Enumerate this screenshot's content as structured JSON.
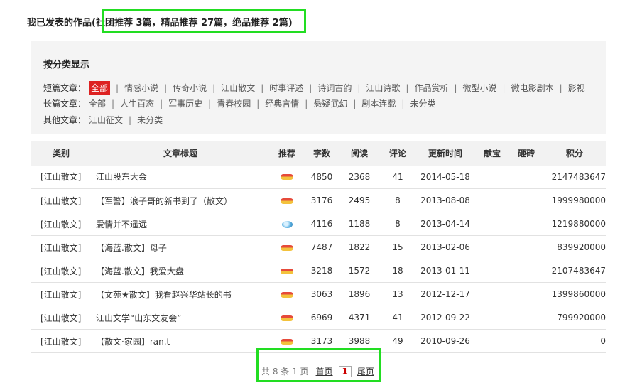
{
  "header": {
    "title": "我已发表的作品",
    "stats": "(社团推荐 3篇，精品推荐 27篇，绝品推荐 2篇)"
  },
  "categories": {
    "heading": "按分类显示",
    "short": {
      "label": "短篇文章：",
      "items": [
        "全部",
        "情感小说",
        "传奇小说",
        "江山散文",
        "时事评述",
        "诗词古韵",
        "江山诗歌",
        "作品赏析",
        "微型小说",
        "微电影剧本",
        "影视"
      ]
    },
    "long": {
      "label": "长篇文章：",
      "items": [
        "全部",
        "人生百态",
        "军事历史",
        "青春校园",
        "经典言情",
        "悬疑武幻",
        "剧本连载",
        "未分类"
      ]
    },
    "other": {
      "label": "其他文章：",
      "items": [
        "江山征文",
        "未分类"
      ]
    },
    "active_color": "#dd2222"
  },
  "table": {
    "headers": [
      "类别",
      "文章标题",
      "推荐",
      "字数",
      "阅读",
      "评论",
      "更新时间",
      "献宝",
      "砸砖",
      "积分"
    ],
    "rows": [
      {
        "cat": "[江山散文]",
        "title": "江山股东大会",
        "rec": "medal-icon",
        "words": "4850",
        "reads": "2368",
        "comments": "41",
        "date": "2014-05-18",
        "score": "2147483647"
      },
      {
        "cat": "[江山散文]",
        "title": "【军警】浪子哥的新书到了（散文）",
        "rec": "medal-icon",
        "words": "3176",
        "reads": "2495",
        "comments": "8",
        "date": "2013-08-08",
        "score": "1999980000"
      },
      {
        "cat": "[江山散文]",
        "title": "爱情并不遥远",
        "rec": "gem-icon",
        "words": "4116",
        "reads": "1188",
        "comments": "8",
        "date": "2013-04-14",
        "score": "1219880000"
      },
      {
        "cat": "[江山散文]",
        "title": "【海蓝.散文】母子",
        "rec": "medal-icon",
        "words": "7487",
        "reads": "1822",
        "comments": "15",
        "date": "2013-02-06",
        "score": "839920000"
      },
      {
        "cat": "[江山散文]",
        "title": "【海蓝.散文】我爱大盘",
        "rec": "medal-icon",
        "words": "3218",
        "reads": "1572",
        "comments": "18",
        "date": "2013-01-11",
        "score": "2107483647"
      },
      {
        "cat": "[江山散文]",
        "title": "【文苑★散文】我看赵兴华站长的书",
        "rec": "medal-icon",
        "words": "3063",
        "reads": "1896",
        "comments": "13",
        "date": "2012-12-17",
        "score": "1399860000"
      },
      {
        "cat": "[江山散文]",
        "title": "江山文学“山东文友会”",
        "rec": "medal-icon",
        "words": "6969",
        "reads": "4371",
        "comments": "41",
        "date": "2012-09-22",
        "score": "799920000"
      },
      {
        "cat": "[江山散文]",
        "title": "【散文·家园】ran.t",
        "rec": "medal-icon",
        "words": "3173",
        "reads": "3988",
        "comments": "49",
        "date": "2010-09-26",
        "score": "0"
      }
    ]
  },
  "pager": {
    "summary": "共 8 条 1 页",
    "first": "首页",
    "current": "1",
    "last": "尾页"
  },
  "highlight_color": "#22dd22"
}
